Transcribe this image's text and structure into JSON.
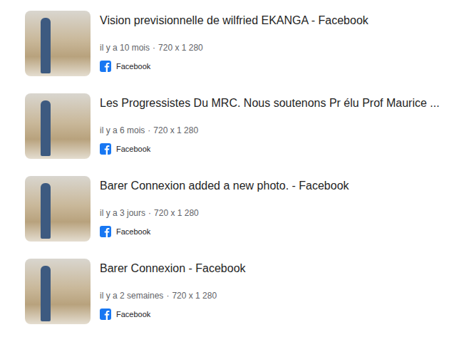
{
  "results": [
    {
      "title": "Vision previsionnelle de wilfried EKANGA - Facebook",
      "age": "il y a 10 mois",
      "size": "720 x 1 280",
      "source": "Facebook"
    },
    {
      "title": "Les Progressistes Du MRC. Nous soutenons Pr élu Prof Maurice ...",
      "age": "il y a 6 mois",
      "size": "720 x 1 280",
      "source": "Facebook"
    },
    {
      "title": "Barer Connexion added a new photo. - Facebook",
      "age": "il y a 3 jours",
      "size": "720 x 1 280",
      "source": "Facebook"
    },
    {
      "title": "Barer Connexion - Facebook",
      "age": "il y a 2 semaines",
      "size": "720 x 1 280",
      "source": "Facebook"
    }
  ],
  "meta_separator": "·"
}
